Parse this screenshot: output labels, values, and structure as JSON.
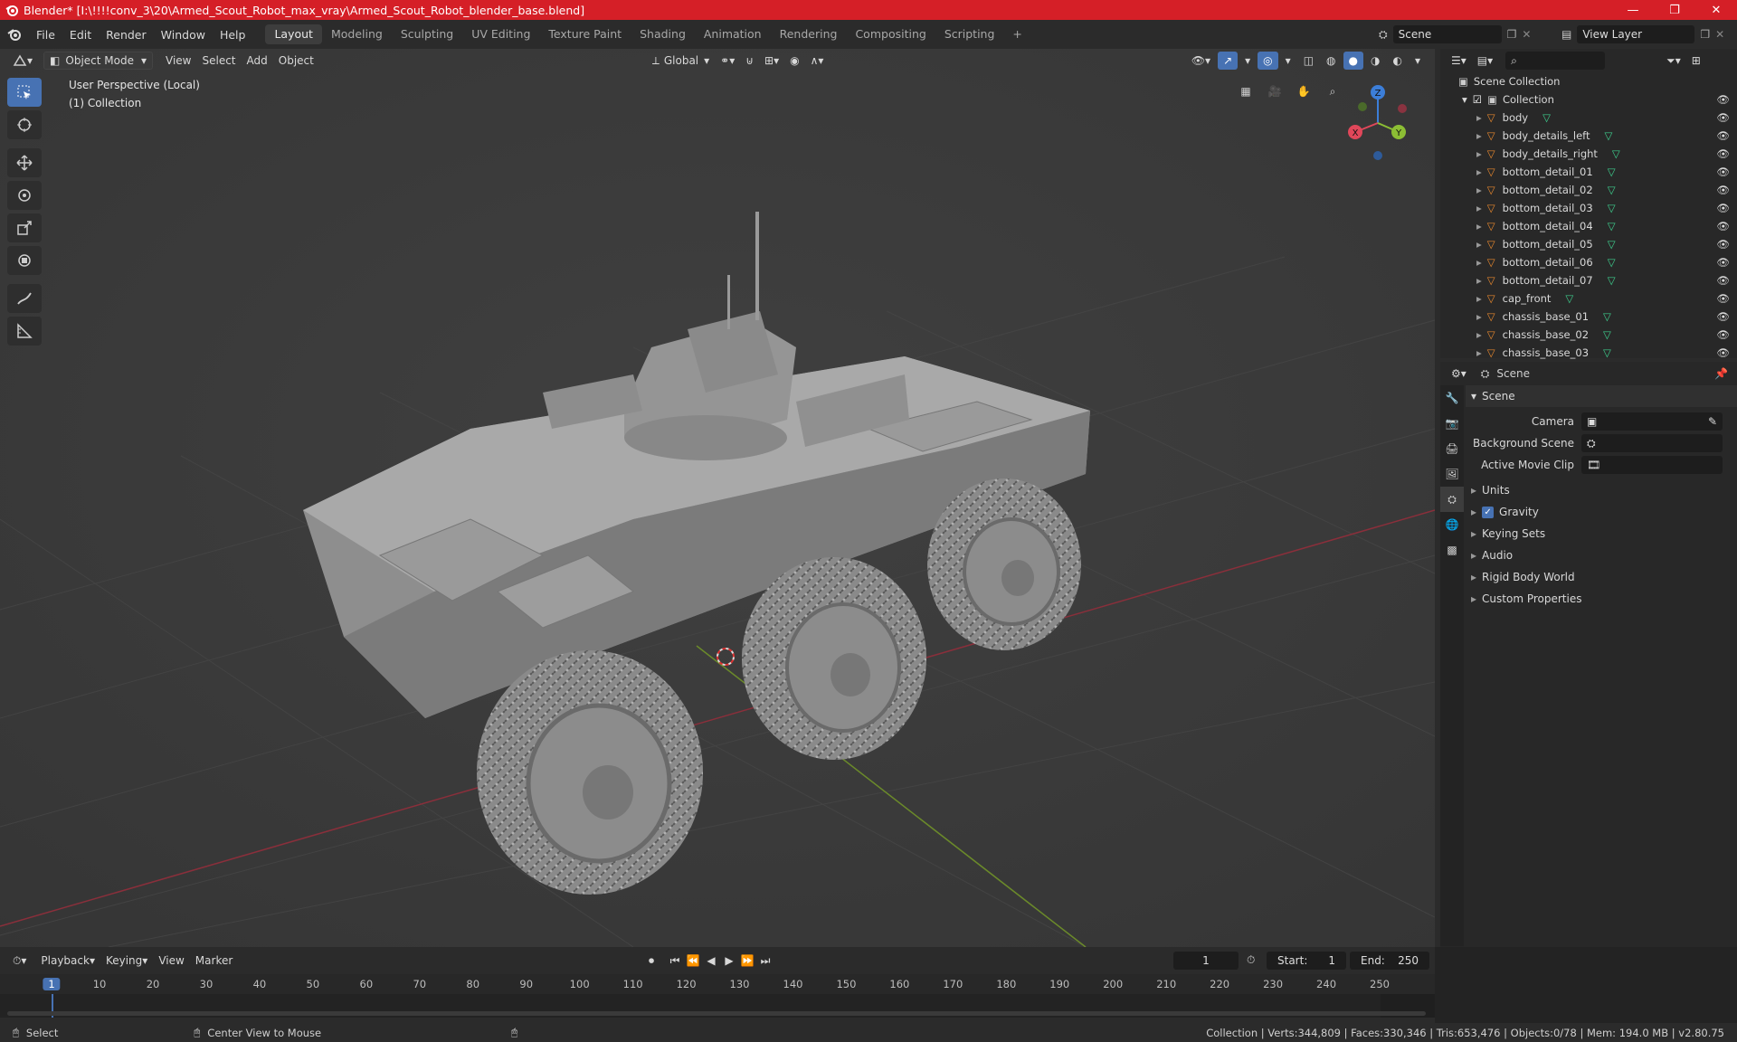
{
  "titlebar": {
    "title": "Blender* [I:\\!!!!conv_3\\20\\Armed_Scout_Robot_max_vray\\Armed_Scout_Robot_blender_base.blend]",
    "buttons": [
      "—",
      "❐",
      "✕"
    ]
  },
  "menu": {
    "items": [
      "File",
      "Edit",
      "Render",
      "Window",
      "Help"
    ]
  },
  "workspaces": {
    "tabs": [
      "Layout",
      "Modeling",
      "Sculpting",
      "UV Editing",
      "Texture Paint",
      "Shading",
      "Animation",
      "Rendering",
      "Compositing",
      "Scripting"
    ],
    "active": "Layout",
    "add": "+"
  },
  "scene_selector": {
    "value": "Scene"
  },
  "view_layer_selector": {
    "value": "View Layer"
  },
  "viewport_header": {
    "mode": "Object Mode",
    "menus": [
      "View",
      "Select",
      "Add",
      "Object"
    ],
    "orientation": "Global"
  },
  "viewport": {
    "perspective_label": "User Perspective (Local)",
    "collection_label": "(1) Collection",
    "gizmo": {
      "x": "X",
      "y": "Y",
      "z": "Z"
    },
    "colors": {
      "x_axis": "#e0475a",
      "y_axis": "#8cbe34",
      "z_axis": "#3c7ed8",
      "selected_tool": "#4772b3"
    }
  },
  "outliner": {
    "root": "Scene Collection",
    "collection": "Collection",
    "objects": [
      "body",
      "body_details_left",
      "body_details_right",
      "bottom_detail_01",
      "bottom_detail_02",
      "bottom_detail_03",
      "bottom_detail_04",
      "bottom_detail_05",
      "bottom_detail_06",
      "bottom_detail_07",
      "cap_front",
      "chassis_base_01",
      "chassis_base_02",
      "chassis_base_03"
    ]
  },
  "properties": {
    "context": "Scene",
    "panel_title": "Scene",
    "fields": [
      {
        "label": "Camera",
        "value": ""
      },
      {
        "label": "Background Scene",
        "value": ""
      },
      {
        "label": "Active Movie Clip",
        "value": ""
      }
    ],
    "sections": [
      {
        "label": "Units",
        "checkbox": false
      },
      {
        "label": "Gravity",
        "checkbox": true
      },
      {
        "label": "Keying Sets",
        "checkbox": false
      },
      {
        "label": "Audio",
        "checkbox": false
      },
      {
        "label": "Rigid Body World",
        "checkbox": false
      },
      {
        "label": "Custom Properties",
        "checkbox": false
      }
    ]
  },
  "timeline": {
    "menus": [
      "Playback",
      "Keying",
      "View",
      "Marker"
    ],
    "current_frame": "1",
    "start_label": "Start:",
    "start": "1",
    "end_label": "End:",
    "end": "250",
    "ticks": [
      "1",
      "10",
      "20",
      "30",
      "40",
      "50",
      "60",
      "70",
      "80",
      "90",
      "100",
      "110",
      "120",
      "130",
      "140",
      "150",
      "160",
      "170",
      "180",
      "190",
      "200",
      "210",
      "220",
      "230",
      "240",
      "250"
    ]
  },
  "statusbar": {
    "left": "Select",
    "middle": "Center View to Mouse",
    "right": "Collection | Verts:344,809 | Faces:330,346 | Tris:653,476 | Objects:0/78 | Mem: 194.0 MB | v2.80.75"
  }
}
